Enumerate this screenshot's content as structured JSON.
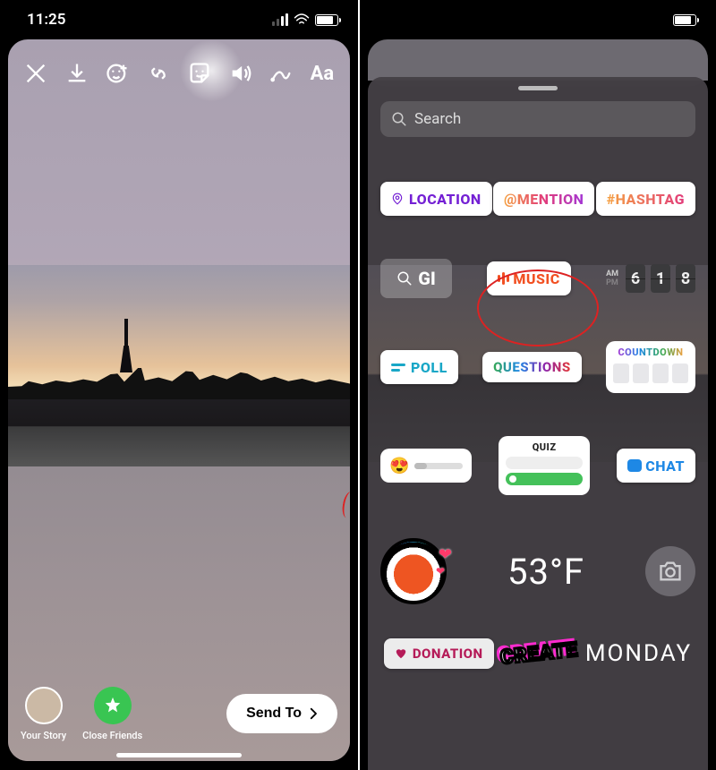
{
  "status": {
    "time": "11:25"
  },
  "left": {
    "bottom": {
      "your_story": "Your Story",
      "close_friends": "Close Friends",
      "send_to": "Send To"
    }
  },
  "right": {
    "search_placeholder": "Search",
    "stickers": {
      "location": "LOCATION",
      "mention": "@MENTION",
      "hashtag": "#HASHTAG",
      "gif": "GI",
      "music": "MUSIC",
      "clock": {
        "am": "AM",
        "pm": "PM",
        "d1": "6",
        "d2": "1",
        "d3": "8"
      },
      "poll": "POLL",
      "questions": "QUESTIONS",
      "countdown": "COUNTDOWN",
      "quiz": "QUIZ",
      "chat": "CHAT",
      "temperature": "53°F",
      "donation": "DONATION",
      "create": "CREATE",
      "monday": "MONDAY"
    }
  }
}
